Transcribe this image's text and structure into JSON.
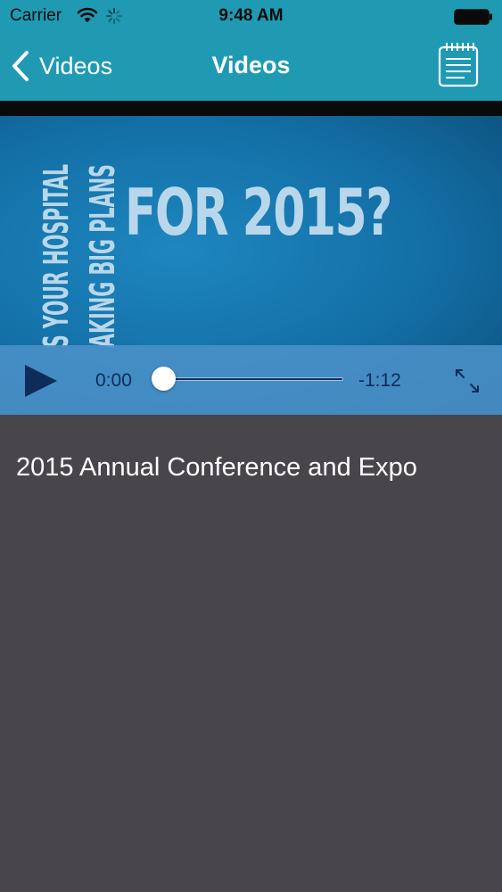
{
  "status_bar": {
    "carrier": "Carrier",
    "time": "9:48 AM",
    "icons": [
      "wifi-icon",
      "activity-spinner-icon",
      "battery-icon"
    ]
  },
  "nav": {
    "back_label": "Videos",
    "title": "Videos",
    "right_icon": "notepad-icon"
  },
  "video": {
    "frame_vertical_text_line1": "S YOUR HOSPITAL",
    "frame_vertical_text_line2": "AKING BIG PLANS",
    "frame_big_text": "FOR 2015?",
    "elapsed": "0:00",
    "remaining": "-1:12",
    "progress": 0,
    "icons": [
      "play-icon",
      "fullscreen-icon"
    ]
  },
  "content": {
    "title": "2015 Annual Conference and Expo"
  },
  "colors": {
    "nav_bar": "#1f9ab2",
    "video_bg": "#136fa6",
    "controls_bg": "#4b91c8",
    "control_dark": "#0d2c5a",
    "content_bg": "#48464b"
  }
}
